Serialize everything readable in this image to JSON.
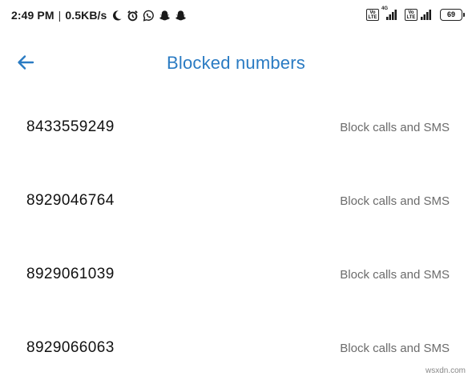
{
  "status_bar": {
    "time": "2:49 PM",
    "separator": "|",
    "net_speed": "0.5KB/s",
    "left_icons": [
      "moon-icon",
      "alarm-icon",
      "whatsapp-icon",
      "snapchat-icon",
      "snapchat-icon"
    ],
    "volte_1": "Vo LTE",
    "network_type": "4G",
    "volte_2": "Vo LTE",
    "battery": "69"
  },
  "header": {
    "back_icon": "back-arrow-icon",
    "title": "Blocked numbers"
  },
  "blocked_numbers": [
    {
      "number": "8433559249",
      "mode": "Block calls and SMS"
    },
    {
      "number": "8929046764",
      "mode": "Block calls and SMS"
    },
    {
      "number": "8929061039",
      "mode": "Block calls and SMS"
    },
    {
      "number": "8929066063",
      "mode": "Block calls and SMS"
    }
  ],
  "watermark": "wsxdn.com",
  "colors": {
    "accent": "#2a7bc3",
    "primary_text": "#111111",
    "secondary_text": "#6b6b6b",
    "background": "#ffffff"
  }
}
